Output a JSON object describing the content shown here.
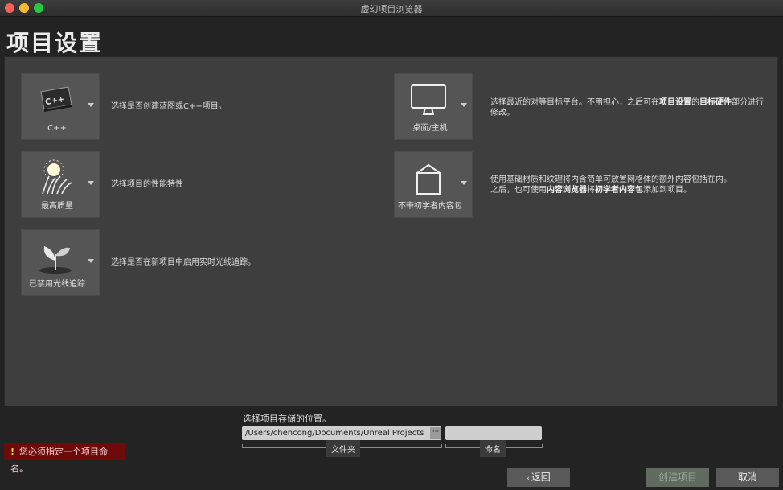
{
  "window": {
    "title": "虚幻项目浏览器"
  },
  "page": {
    "title": "项目设置"
  },
  "tiles": [
    {
      "label": "C++",
      "icon": "cpp-icon",
      "description": "选择是否创建蓝图或C++项目。"
    },
    {
      "label": "最高质量",
      "icon": "quality-icon",
      "description": "选择项目的性能特性"
    },
    {
      "label": "已禁用光线追踪",
      "icon": "raytracing-icon",
      "description": "选择是否在新项目中启用实时光线追踪。"
    },
    {
      "label": "桌面/主机",
      "icon": "monitor-icon",
      "description": {
        "p1": "选择最近的对等目标平台。不用担心，之后可在",
        "b1": "项目设置",
        "p2": "的",
        "b2": "目标硬件",
        "p3": "部分进行",
        "line2": "修改。"
      }
    },
    {
      "label": "不带初学者内容包",
      "icon": "box-icon",
      "description": {
        "line1": "使用基础材质和纹理将内含简单可放置网格体的额外内容包括在内。",
        "p1": "之后，也可使用",
        "b1": "内容浏览器",
        "p2": "将",
        "b2": "初学者内容包",
        "p3": "添加到项目。"
      }
    }
  ],
  "location": {
    "label": "选择项目存储的位置。",
    "path": "/Users/chencong/Documents/Unreal Projects",
    "browse": "···",
    "folder_caption": "文件夹",
    "name_value": "",
    "name_caption": "命名"
  },
  "error": {
    "icon": "!",
    "text": "您必须指定一个项目命名。"
  },
  "buttons": {
    "back": "返回",
    "create": "创建项目",
    "cancel": "取消"
  },
  "colors": {
    "error_bg": "#6e0a0a",
    "panel_bg": "#3e3e3e",
    "tile_bg": "#555555"
  }
}
